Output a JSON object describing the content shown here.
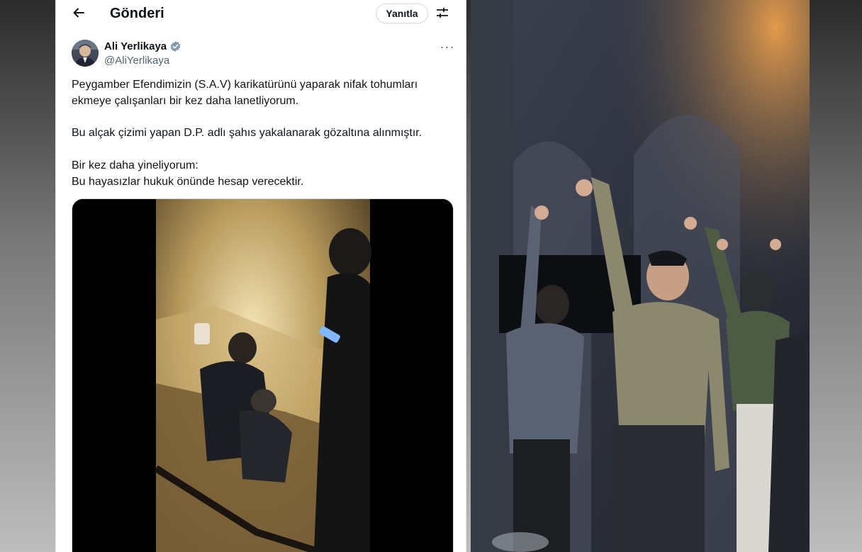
{
  "header": {
    "title": "Gönderi",
    "reply_label": "Yanıtla",
    "back_icon": "arrow-left-icon",
    "filter_icon": "sliders-icon"
  },
  "tweet": {
    "author_name": "Ali Yerlikaya",
    "author_handle": "@AliYerlikaya",
    "verified": true,
    "more_icon": "more-horizontal-icon",
    "more_label": "···",
    "paragraph1_line1": "Peygamber Efendimizin (S.A.V) karikatürünü yaparak nifak tohumları",
    "paragraph1_line2": "ekmeye çalışanları bir kez daha lanetliyorum.",
    "paragraph2": "Bu alçak çizimi yapan D.P. adlı şahıs yakalanarak gözaltına alınmıştır.",
    "paragraph3_line1": "Bir kez daha yineliyorum:",
    "paragraph3_line2": "Bu hayasızlar hukuk önünde hesap verecektir."
  },
  "colors": {
    "text_primary": "#0f1419",
    "text_secondary": "#536471",
    "verified_badge": "#829aab",
    "border": "#cfd9de"
  }
}
